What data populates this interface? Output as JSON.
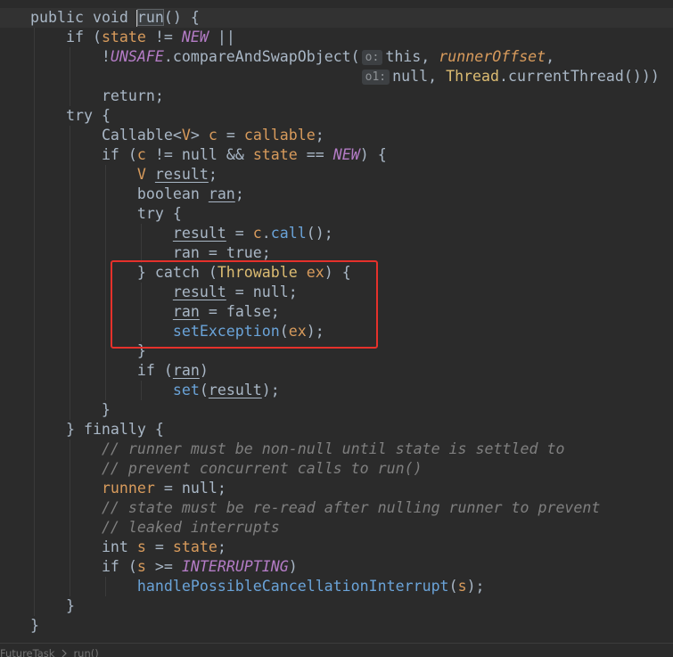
{
  "colors": {
    "background": "#2b2b2b",
    "text": "#a9b7c6",
    "keyword": "#a9b7c6",
    "field": "#d89b5c",
    "constant": "#b47cc6",
    "method": "#6aa3d8",
    "class_name": "#dcbc72",
    "comment": "#7f7f7f",
    "annotation_box": "#e5312b"
  },
  "editor": {
    "lines": [
      [
        [
          "public",
          "kw"
        ],
        [
          " ",
          "p"
        ],
        [
          "void",
          "kw"
        ],
        [
          " ",
          "p"
        ],
        [
          "run",
          "decl"
        ],
        [
          "() {",
          "p"
        ]
      ],
      [
        [
          "    ",
          "p"
        ],
        [
          "if",
          "kw"
        ],
        [
          " (",
          "p"
        ],
        [
          "state",
          "fld"
        ],
        [
          " != ",
          "p"
        ],
        [
          "NEW",
          "const"
        ],
        [
          " ||",
          "p"
        ]
      ],
      [
        [
          "        !",
          "p"
        ],
        [
          "UNSAFE",
          "const"
        ],
        [
          ".compareAndSwapObject(",
          "p"
        ],
        [
          "o:",
          "hint"
        ],
        [
          "this",
          "kw"
        ],
        [
          ", ",
          "p"
        ],
        [
          "runnerOffset",
          "sfld"
        ],
        [
          ",",
          "p"
        ]
      ],
      [
        [
          "                                     ",
          "p"
        ],
        [
          "o1:",
          "hint"
        ],
        [
          "null",
          "kw"
        ],
        [
          ", ",
          "p"
        ],
        [
          "Thread",
          "cls"
        ],
        [
          ".currentThread()))",
          "p"
        ]
      ],
      [
        [
          "        ",
          "p"
        ],
        [
          "return",
          "kw"
        ],
        [
          ";",
          "p"
        ]
      ],
      [
        [
          "    ",
          "p"
        ],
        [
          "try",
          "kw"
        ],
        [
          " {",
          "p"
        ]
      ],
      [
        [
          "        ",
          "p"
        ],
        [
          "Callable",
          "typ"
        ],
        [
          "<",
          "p"
        ],
        [
          "V",
          "tp"
        ],
        [
          "> ",
          "p"
        ],
        [
          "c",
          "loc"
        ],
        [
          " = ",
          "p"
        ],
        [
          "callable",
          "fld"
        ],
        [
          ";",
          "p"
        ]
      ],
      [
        [
          "        ",
          "p"
        ],
        [
          "if",
          "kw"
        ],
        [
          " (",
          "p"
        ],
        [
          "c",
          "loc"
        ],
        [
          " != ",
          "p"
        ],
        [
          "null",
          "kw"
        ],
        [
          " && ",
          "p"
        ],
        [
          "state",
          "fld"
        ],
        [
          " == ",
          "p"
        ],
        [
          "NEW",
          "const"
        ],
        [
          ") {",
          "p"
        ]
      ],
      [
        [
          "            ",
          "p"
        ],
        [
          "V",
          "tp"
        ],
        [
          " ",
          "p"
        ],
        [
          "result",
          "var"
        ],
        [
          ";",
          "p"
        ]
      ],
      [
        [
          "            ",
          "p"
        ],
        [
          "boolean",
          "kw"
        ],
        [
          " ",
          "p"
        ],
        [
          "ran",
          "var"
        ],
        [
          ";",
          "p"
        ]
      ],
      [
        [
          "            ",
          "p"
        ],
        [
          "try",
          "kw"
        ],
        [
          " {",
          "p"
        ]
      ],
      [
        [
          "                ",
          "p"
        ],
        [
          "result",
          "var"
        ],
        [
          " = ",
          "p"
        ],
        [
          "c",
          "loc"
        ],
        [
          ".",
          "p"
        ],
        [
          "call",
          "mth"
        ],
        [
          "();",
          "p"
        ]
      ],
      [
        [
          "                ",
          "p"
        ],
        [
          "ran",
          "var"
        ],
        [
          " = ",
          "p"
        ],
        [
          "true",
          "kw"
        ],
        [
          ";",
          "p"
        ]
      ],
      [
        [
          "            } ",
          "p"
        ],
        [
          "catch",
          "kw"
        ],
        [
          " (",
          "p"
        ],
        [
          "Throwable",
          "cls"
        ],
        [
          " ",
          "p"
        ],
        [
          "ex",
          "prm"
        ],
        [
          ") {",
          "p"
        ]
      ],
      [
        [
          "                ",
          "p"
        ],
        [
          "result",
          "var"
        ],
        [
          " = ",
          "p"
        ],
        [
          "null",
          "kw"
        ],
        [
          ";",
          "p"
        ]
      ],
      [
        [
          "                ",
          "p"
        ],
        [
          "ran",
          "var"
        ],
        [
          " = ",
          "p"
        ],
        [
          "false",
          "kw"
        ],
        [
          ";",
          "p"
        ]
      ],
      [
        [
          "                ",
          "p"
        ],
        [
          "setException",
          "mth"
        ],
        [
          "(",
          "p"
        ],
        [
          "ex",
          "prm"
        ],
        [
          ");",
          "p"
        ]
      ],
      [
        [
          "            }",
          "p"
        ]
      ],
      [
        [
          "            ",
          "p"
        ],
        [
          "if",
          "kw"
        ],
        [
          " (",
          "p"
        ],
        [
          "ran",
          "var"
        ],
        [
          ")",
          "p"
        ]
      ],
      [
        [
          "                ",
          "p"
        ],
        [
          "set",
          "mth"
        ],
        [
          "(",
          "p"
        ],
        [
          "result",
          "var"
        ],
        [
          ");",
          "p"
        ]
      ],
      [
        [
          "        }",
          "p"
        ]
      ],
      [
        [
          "    } ",
          "p"
        ],
        [
          "finally",
          "kw"
        ],
        [
          " {",
          "p"
        ]
      ],
      [
        [
          "        ",
          "p"
        ],
        [
          "// runner must be non-null until state is settled to",
          "cmt"
        ]
      ],
      [
        [
          "        ",
          "p"
        ],
        [
          "// prevent concurrent calls to run()",
          "cmt"
        ]
      ],
      [
        [
          "        ",
          "p"
        ],
        [
          "runner",
          "fld"
        ],
        [
          " = ",
          "p"
        ],
        [
          "null",
          "kw"
        ],
        [
          ";",
          "p"
        ]
      ],
      [
        [
          "        ",
          "p"
        ],
        [
          "// state must be re-read after nulling runner to prevent",
          "cmt"
        ]
      ],
      [
        [
          "        ",
          "p"
        ],
        [
          "// leaked interrupts",
          "cmt"
        ]
      ],
      [
        [
          "        ",
          "p"
        ],
        [
          "int",
          "kw"
        ],
        [
          " ",
          "p"
        ],
        [
          "s",
          "loc"
        ],
        [
          " = ",
          "p"
        ],
        [
          "state",
          "fld"
        ],
        [
          ";",
          "p"
        ]
      ],
      [
        [
          "        ",
          "p"
        ],
        [
          "if",
          "kw"
        ],
        [
          " (",
          "p"
        ],
        [
          "s",
          "loc"
        ],
        [
          " >= ",
          "p"
        ],
        [
          "INTERRUPTING",
          "const"
        ],
        [
          ")",
          "p"
        ]
      ],
      [
        [
          "            ",
          "p"
        ],
        [
          "handlePossibleCancellationInterrupt",
          "mth"
        ],
        [
          "(",
          "p"
        ],
        [
          "s",
          "loc"
        ],
        [
          ");",
          "p"
        ]
      ],
      [
        [
          "    }",
          "p"
        ]
      ],
      [
        [
          "}",
          "p"
        ]
      ]
    ]
  },
  "breadcrumb": {
    "items": [
      "FutureTask",
      "run()"
    ]
  }
}
